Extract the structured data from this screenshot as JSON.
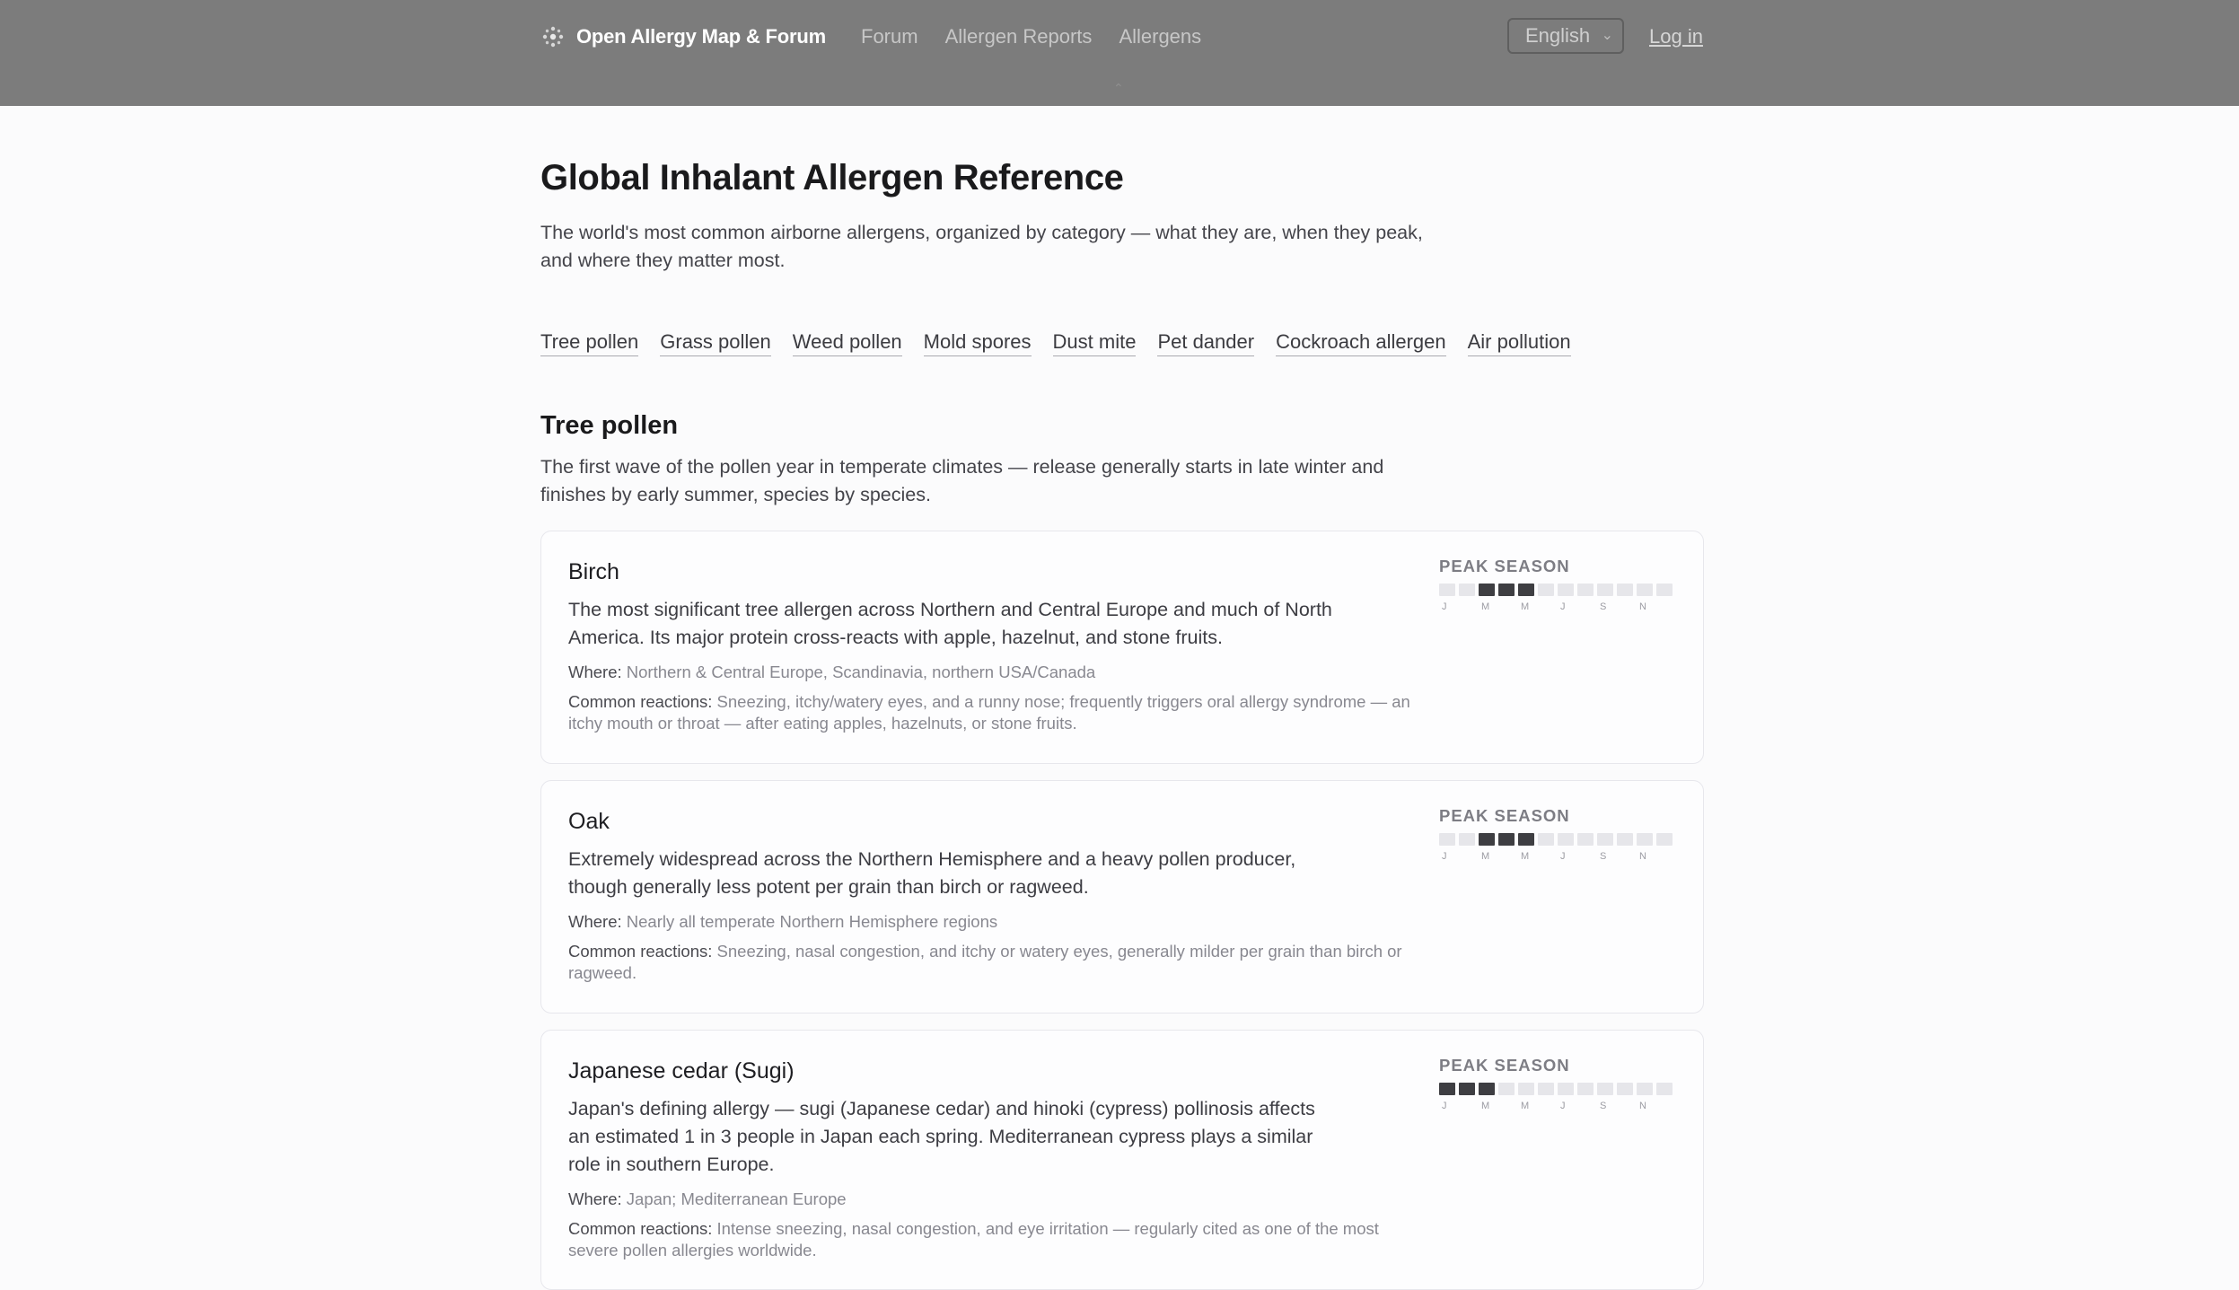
{
  "header": {
    "brand": "Open Allergy Map & Forum",
    "nav": [
      "Forum",
      "Allergen Reports",
      "Allergens"
    ],
    "language": "English",
    "login": "Log in"
  },
  "page": {
    "title": "Global Inhalant Allergen Reference",
    "subtitle": "The world's most common airborne allergens, organized by category — what they are, when they peak, and where they matter most."
  },
  "categories": [
    "Tree pollen",
    "Grass pollen",
    "Weed pollen",
    "Mold spores",
    "Dust mite",
    "Pet dander",
    "Cockroach allergen",
    "Air pollution"
  ],
  "section": {
    "title": "Tree pollen",
    "description": "The first wave of the pollen year in temperate climates — release generally starts in late winter and finishes by early summer, species by species."
  },
  "labels": {
    "peak": "PEAK SEASON",
    "where": "Where:",
    "reactions": "Common reactions:",
    "months": [
      "J",
      "M",
      "M",
      "J",
      "S",
      "N"
    ]
  },
  "allergens": [
    {
      "name": "Birch",
      "description": "The most significant tree allergen across Northern and Central Europe and much of North America. Its major protein cross-reacts with apple, hazelnut, and stone fruits.",
      "where": "Northern & Central Europe, Scandinavia, northern USA/Canada",
      "reactions": "Sneezing, itchy/watery eyes, and a runny nose; frequently triggers oral allergy syndrome — an itchy mouth or throat — after eating apples, hazelnuts, or stone fruits.",
      "peak_months": [
        3,
        4,
        5
      ]
    },
    {
      "name": "Oak",
      "description": "Extremely widespread across the Northern Hemisphere and a heavy pollen producer, though generally less potent per grain than birch or ragweed.",
      "where": "Nearly all temperate Northern Hemisphere regions",
      "reactions": "Sneezing, nasal congestion, and itchy or watery eyes, generally milder per grain than birch or ragweed.",
      "peak_months": [
        3,
        4,
        5
      ]
    },
    {
      "name": "Japanese cedar (Sugi)",
      "description": "Japan's defining allergy — sugi (Japanese cedar) and hinoki (cypress) pollinosis affects an estimated 1 in 3 people in Japan each spring. Mediterranean cypress plays a similar role in southern Europe.",
      "where": "Japan; Mediterranean Europe",
      "reactions": "Intense sneezing, nasal congestion, and eye irritation — regularly cited as one of the most severe pollen allergies worldwide.",
      "peak_months": [
        1,
        2,
        3
      ]
    }
  ]
}
